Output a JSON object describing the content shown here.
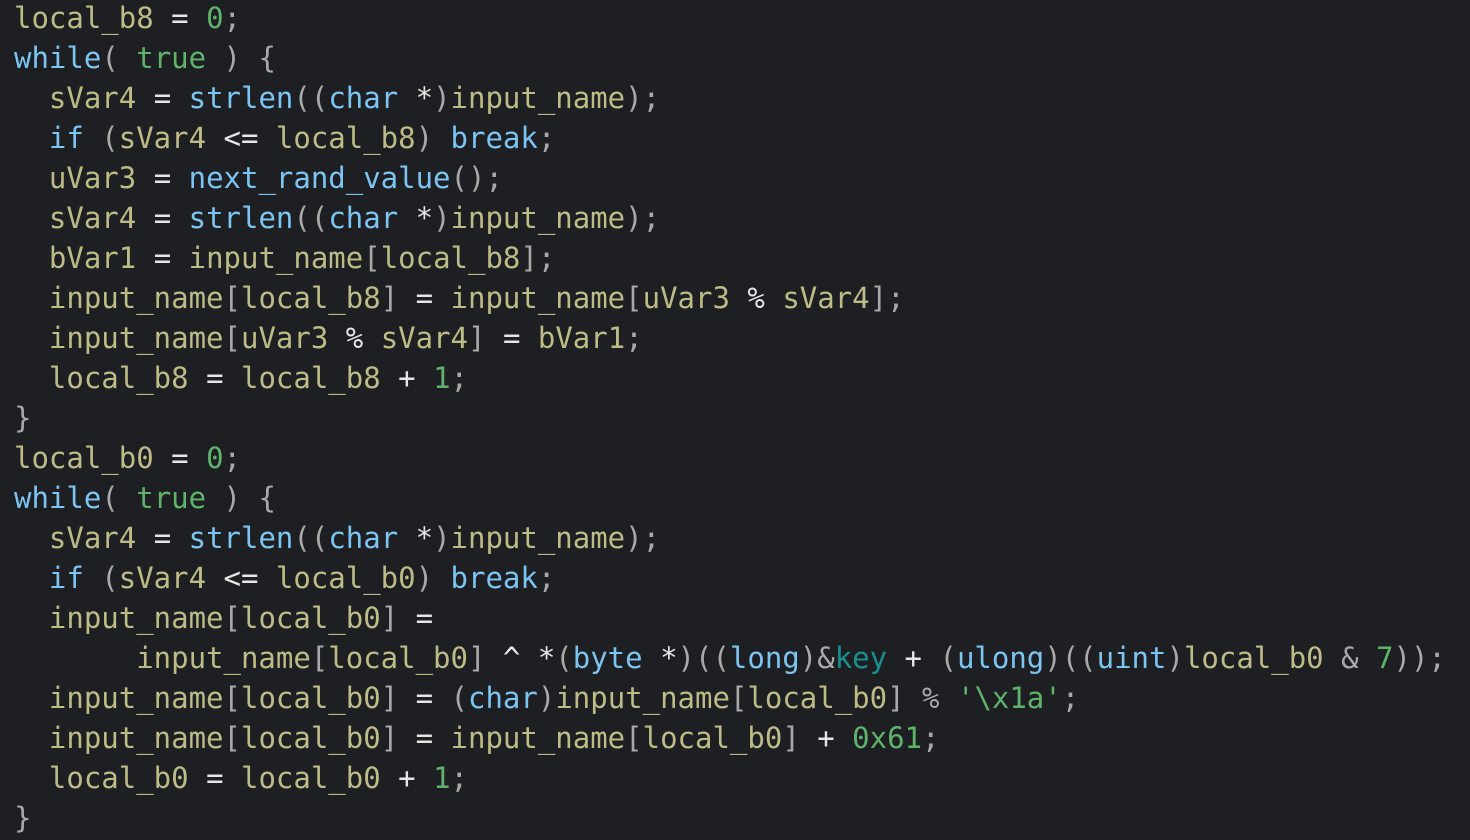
{
  "colors": {
    "background": "#1e1f22",
    "variable": "#bdbb86",
    "keyword_function_type": "#7cc4f2",
    "literal": "#5fb36b",
    "punctuation": "#a9a9a9",
    "operator": "#e6e6e6",
    "global": "#1b8f8f"
  },
  "code_lines": [
    [
      [
        "v",
        "local_b8"
      ],
      [
        "o",
        " = "
      ],
      [
        "n",
        "0"
      ],
      [
        "p",
        ";"
      ]
    ],
    [
      [
        "f",
        "while"
      ],
      [
        "p",
        "( "
      ],
      [
        "n",
        "true"
      ],
      [
        "p",
        " ) {"
      ]
    ],
    [
      [
        "o",
        "  "
      ],
      [
        "v",
        "sVar4"
      ],
      [
        "o",
        " = "
      ],
      [
        "f",
        "strlen"
      ],
      [
        "p",
        "(("
      ],
      [
        "f",
        "char"
      ],
      [
        "o",
        " *"
      ],
      [
        "p",
        ")"
      ],
      [
        "v",
        "input_name"
      ],
      [
        "p",
        ");"
      ]
    ],
    [
      [
        "o",
        "  "
      ],
      [
        "f",
        "if"
      ],
      [
        "p",
        " ("
      ],
      [
        "v",
        "sVar4"
      ],
      [
        "o",
        " <= "
      ],
      [
        "v",
        "local_b8"
      ],
      [
        "p",
        ") "
      ],
      [
        "f",
        "break"
      ],
      [
        "p",
        ";"
      ]
    ],
    [
      [
        "o",
        "  "
      ],
      [
        "v",
        "uVar3"
      ],
      [
        "o",
        " = "
      ],
      [
        "f",
        "next_rand_value"
      ],
      [
        "p",
        "();"
      ]
    ],
    [
      [
        "o",
        "  "
      ],
      [
        "v",
        "sVar4"
      ],
      [
        "o",
        " = "
      ],
      [
        "f",
        "strlen"
      ],
      [
        "p",
        "(("
      ],
      [
        "f",
        "char"
      ],
      [
        "o",
        " *"
      ],
      [
        "p",
        ")"
      ],
      [
        "v",
        "input_name"
      ],
      [
        "p",
        ");"
      ]
    ],
    [
      [
        "o",
        "  "
      ],
      [
        "v",
        "bVar1"
      ],
      [
        "o",
        " = "
      ],
      [
        "v",
        "input_name"
      ],
      [
        "p",
        "["
      ],
      [
        "v",
        "local_b8"
      ],
      [
        "p",
        "];"
      ]
    ],
    [
      [
        "o",
        "  "
      ],
      [
        "v",
        "input_name"
      ],
      [
        "p",
        "["
      ],
      [
        "v",
        "local_b8"
      ],
      [
        "p",
        "]"
      ],
      [
        "o",
        " = "
      ],
      [
        "v",
        "input_name"
      ],
      [
        "p",
        "["
      ],
      [
        "v",
        "uVar3"
      ],
      [
        "o",
        " % "
      ],
      [
        "v",
        "sVar4"
      ],
      [
        "p",
        "];"
      ]
    ],
    [
      [
        "o",
        "  "
      ],
      [
        "v",
        "input_name"
      ],
      [
        "p",
        "["
      ],
      [
        "v",
        "uVar3"
      ],
      [
        "o",
        " % "
      ],
      [
        "v",
        "sVar4"
      ],
      [
        "p",
        "]"
      ],
      [
        "o",
        " = "
      ],
      [
        "v",
        "bVar1"
      ],
      [
        "p",
        ";"
      ]
    ],
    [
      [
        "o",
        "  "
      ],
      [
        "v",
        "local_b8"
      ],
      [
        "o",
        " = "
      ],
      [
        "v",
        "local_b8"
      ],
      [
        "o",
        " + "
      ],
      [
        "n",
        "1"
      ],
      [
        "p",
        ";"
      ]
    ],
    [
      [
        "p",
        "}"
      ]
    ],
    [
      [
        "v",
        "local_b0"
      ],
      [
        "o",
        " = "
      ],
      [
        "n",
        "0"
      ],
      [
        "p",
        ";"
      ]
    ],
    [
      [
        "f",
        "while"
      ],
      [
        "p",
        "( "
      ],
      [
        "n",
        "true"
      ],
      [
        "p",
        " ) {"
      ]
    ],
    [
      [
        "o",
        "  "
      ],
      [
        "v",
        "sVar4"
      ],
      [
        "o",
        " = "
      ],
      [
        "f",
        "strlen"
      ],
      [
        "p",
        "(("
      ],
      [
        "f",
        "char"
      ],
      [
        "o",
        " *"
      ],
      [
        "p",
        ")"
      ],
      [
        "v",
        "input_name"
      ],
      [
        "p",
        ");"
      ]
    ],
    [
      [
        "o",
        "  "
      ],
      [
        "f",
        "if"
      ],
      [
        "p",
        " ("
      ],
      [
        "v",
        "sVar4"
      ],
      [
        "o",
        " <= "
      ],
      [
        "v",
        "local_b0"
      ],
      [
        "p",
        ") "
      ],
      [
        "f",
        "break"
      ],
      [
        "p",
        ";"
      ]
    ],
    [
      [
        "o",
        "  "
      ],
      [
        "v",
        "input_name"
      ],
      [
        "p",
        "["
      ],
      [
        "v",
        "local_b0"
      ],
      [
        "p",
        "]"
      ],
      [
        "o",
        " ="
      ]
    ],
    [
      [
        "o",
        "       "
      ],
      [
        "v",
        "input_name"
      ],
      [
        "p",
        "["
      ],
      [
        "v",
        "local_b0"
      ],
      [
        "p",
        "]"
      ],
      [
        "o",
        " ^ *"
      ],
      [
        "p",
        "("
      ],
      [
        "f",
        "byte"
      ],
      [
        "o",
        " *"
      ],
      [
        "p",
        ")(("
      ],
      [
        "f",
        "long"
      ],
      [
        "p",
        ")&"
      ],
      [
        "g",
        "key"
      ],
      [
        "o",
        " + "
      ],
      [
        "p",
        "("
      ],
      [
        "f",
        "ulong"
      ],
      [
        "p",
        ")(("
      ],
      [
        "f",
        "uint"
      ],
      [
        "p",
        ")"
      ],
      [
        "v",
        "local_b0"
      ],
      [
        "p",
        " & "
      ],
      [
        "n",
        "7"
      ],
      [
        "p",
        "));"
      ]
    ],
    [
      [
        "o",
        "  "
      ],
      [
        "v",
        "input_name"
      ],
      [
        "p",
        "["
      ],
      [
        "v",
        "local_b0"
      ],
      [
        "p",
        "]"
      ],
      [
        "o",
        " = "
      ],
      [
        "p",
        "("
      ],
      [
        "f",
        "char"
      ],
      [
        "p",
        ")"
      ],
      [
        "v",
        "input_name"
      ],
      [
        "p",
        "["
      ],
      [
        "v",
        "local_b0"
      ],
      [
        "p",
        "] % "
      ],
      [
        "n",
        "'\\x1a'"
      ],
      [
        "p",
        ";"
      ]
    ],
    [
      [
        "o",
        "  "
      ],
      [
        "v",
        "input_name"
      ],
      [
        "p",
        "["
      ],
      [
        "v",
        "local_b0"
      ],
      [
        "p",
        "]"
      ],
      [
        "o",
        " = "
      ],
      [
        "v",
        "input_name"
      ],
      [
        "p",
        "["
      ],
      [
        "v",
        "local_b0"
      ],
      [
        "p",
        "]"
      ],
      [
        "o",
        " + "
      ],
      [
        "n",
        "0x61"
      ],
      [
        "p",
        ";"
      ]
    ],
    [
      [
        "o",
        "  "
      ],
      [
        "v",
        "local_b0"
      ],
      [
        "o",
        " = "
      ],
      [
        "v",
        "local_b0"
      ],
      [
        "o",
        " + "
      ],
      [
        "n",
        "1"
      ],
      [
        "p",
        ";"
      ]
    ],
    [
      [
        "p",
        "}"
      ]
    ]
  ]
}
